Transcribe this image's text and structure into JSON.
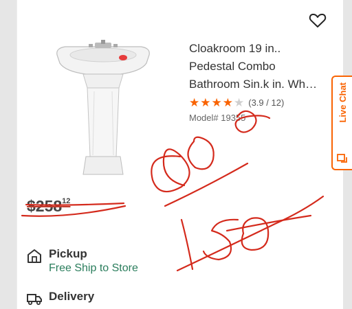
{
  "product": {
    "title_lines": [
      "Cloakroom 19 in..",
      "Pedestal Combo",
      "Bathroom Sin.k in. Wh…"
    ],
    "rating": {
      "stars": 3.9,
      "text": "(3.9 / 12)"
    },
    "model": "Model# 19355",
    "old_price": {
      "dollars": "$258",
      "cents": "12"
    }
  },
  "fulfillment": {
    "pickup": {
      "title": "Pickup",
      "subtitle": "Free Ship to Store"
    },
    "delivery": {
      "title": "Delivery"
    }
  },
  "live_chat": {
    "label": "Live Chat"
  },
  "handwriting": {
    "mark1": "80",
    "mark2": "150"
  },
  "colors": {
    "accent": "#f96302",
    "green": "#2a7d5c",
    "ink": "#d42a1c"
  }
}
